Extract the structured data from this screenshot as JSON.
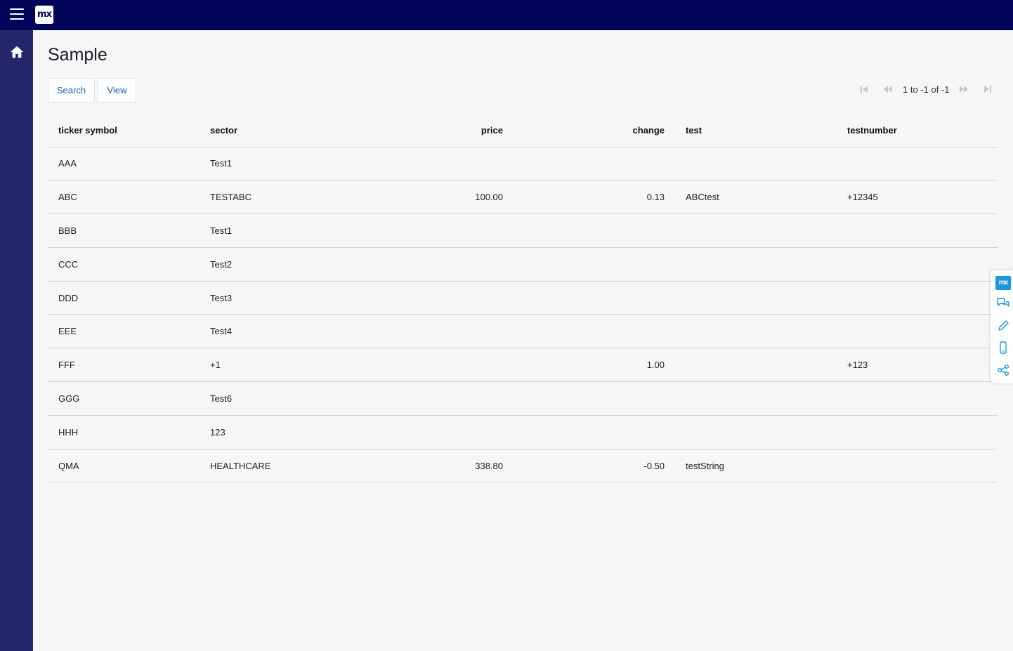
{
  "header": {
    "logo_text": "mx",
    "menu_icon": "hamburger-menu-icon"
  },
  "sidebar": {
    "items": [
      {
        "icon": "home-icon"
      }
    ]
  },
  "page": {
    "title": "Sample"
  },
  "toolbar": {
    "search_label": "Search",
    "view_label": "View"
  },
  "pager": {
    "status": "1 to -1 of -1"
  },
  "table": {
    "columns": [
      "ticker symbol",
      "sector",
      "price",
      "change",
      "test",
      "testnumber"
    ],
    "rows": [
      [
        "AAA",
        "Test1",
        "",
        "",
        "",
        ""
      ],
      [
        "ABC",
        "TESTABC",
        "100.00",
        "0.13",
        "ABCtest",
        "+12345"
      ],
      [
        "BBB",
        "Test1",
        "",
        "",
        "",
        ""
      ],
      [
        "CCC",
        "Test2",
        "",
        "",
        "",
        ""
      ],
      [
        "DDD",
        "Test3",
        "",
        "",
        "",
        ""
      ],
      [
        "EEE",
        "Test4",
        "",
        "",
        "",
        ""
      ],
      [
        "FFF",
        "+1",
        "",
        "1.00",
        "",
        "+123"
      ],
      [
        "GGG",
        "Test6",
        "",
        "",
        "",
        ""
      ],
      [
        "HHH",
        "123",
        "",
        "",
        "",
        ""
      ],
      [
        "QMA",
        "HEALTHCARE",
        "338.80",
        "-0.50",
        "testString",
        ""
      ]
    ]
  },
  "side_tools": {
    "logo_text": "mx",
    "icons": [
      "chat-icon",
      "pencil-icon",
      "mobile-icon",
      "share-icon"
    ]
  },
  "colors": {
    "topbar": "#020557",
    "sidebar": "#24276b",
    "link": "#1f5fb5",
    "tool_accent": "#1c97e0"
  }
}
